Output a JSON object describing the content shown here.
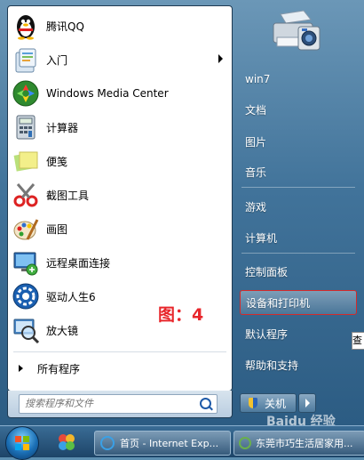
{
  "left_programs": [
    {
      "label": "腾讯QQ",
      "icon": "qq-penguin-icon"
    },
    {
      "label": "入门",
      "icon": "getting-started-icon",
      "has_submenu": true
    },
    {
      "label": "Windows Media Center",
      "icon": "media-center-icon"
    },
    {
      "label": "计算器",
      "icon": "calculator-icon"
    },
    {
      "label": "便笺",
      "icon": "sticky-notes-icon"
    },
    {
      "label": "截图工具",
      "icon": "snipping-tool-icon"
    },
    {
      "label": "画图",
      "icon": "paint-icon"
    },
    {
      "label": "远程桌面连接",
      "icon": "remote-desktop-icon"
    },
    {
      "label": "驱动人生6",
      "icon": "driver-gear-icon"
    },
    {
      "label": "放大镜",
      "icon": "magnifier-icon"
    }
  ],
  "all_programs_label": "所有程序",
  "search": {
    "placeholder": "搜索程序和文件"
  },
  "right_items": [
    {
      "label": "win7"
    },
    {
      "label": "文档"
    },
    {
      "label": "图片"
    },
    {
      "label": "音乐"
    },
    {
      "label": "游戏"
    },
    {
      "label": "计算机"
    },
    {
      "label": "控制面板"
    },
    {
      "label": "设备和打印机",
      "highlighted": true
    },
    {
      "label": "默认程序"
    },
    {
      "label": "帮助和支持"
    }
  ],
  "annotation": "图：4",
  "tooltip_text": "查",
  "shutdown_label": "关机",
  "taskbar": {
    "ie_button_label": "首页 - Internet Exp...",
    "second_button_label": "东莞市巧生活居家用..."
  },
  "watermark": "Baidu 经验",
  "colors": {
    "highlight_border": "#d42a2a",
    "annotation": "#e8262b",
    "accent_blue": "#1e5aa8"
  }
}
